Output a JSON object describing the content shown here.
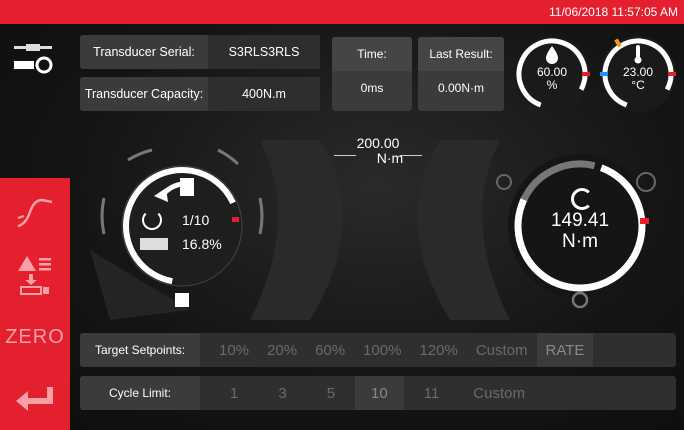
{
  "header": {
    "datetime": "11/06/2018 11:57:05 AM"
  },
  "nav": {
    "zero_label": "ZERO"
  },
  "info": {
    "serial_label": "Transducer Serial:",
    "serial_value": "S3RLS3RLS",
    "capacity_label": "Transducer Capacity:",
    "capacity_value": "400N.m",
    "time_label": "Time:",
    "time_value": "0ms",
    "last_label": "Last Result:",
    "last_value": "0.00N·m"
  },
  "sensors": {
    "humidity_value": "60.00",
    "humidity_unit": "%",
    "temperature_value": "23.00",
    "temperature_unit": "°C"
  },
  "target": {
    "value": "200.00",
    "unit": "N·m"
  },
  "left_dial": {
    "cycle": "1/10",
    "percent": "16.8%"
  },
  "right_dial": {
    "value": "149.41",
    "unit": "N·m"
  },
  "setpoints": {
    "label": "Target Setpoints:",
    "options": [
      "10%",
      "20%",
      "60%",
      "100%",
      "120%",
      "Custom",
      "RATE"
    ],
    "selected_index": 6
  },
  "cycle_limit": {
    "label": "Cycle Limit:",
    "options": [
      "1",
      "3",
      "5",
      "10",
      "11",
      "Custom"
    ],
    "selected_index": 3
  },
  "colors": {
    "accent": "#e5202e",
    "panel": "#3b3b3b",
    "ring_humidity": "#e5202e",
    "ring_temp_cold": "#1e90ff",
    "ring_temp_warm": "#f39c12"
  }
}
